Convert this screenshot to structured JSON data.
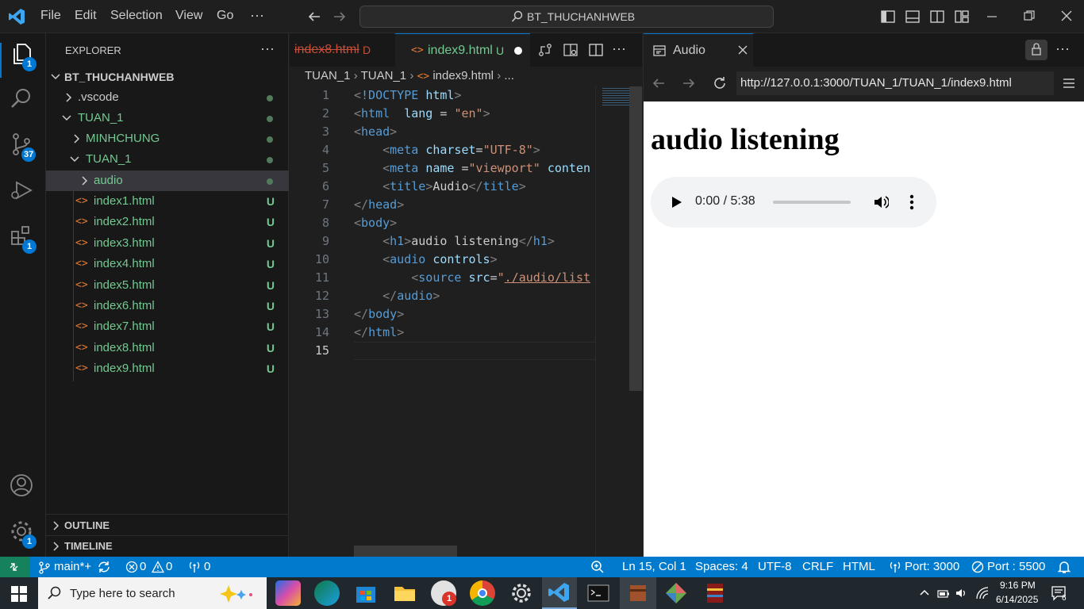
{
  "titlebar": {
    "menu": [
      "File",
      "Edit",
      "Selection",
      "View",
      "Go"
    ],
    "more": "···",
    "search_text": "BT_THUCHANHWEB"
  },
  "activity": {
    "explorer_badge": "1",
    "source_control_badge": "37",
    "extensions_badge": "1",
    "settings_badge": "1"
  },
  "sidebar": {
    "title": "EXPLORER",
    "more": "···",
    "root": "BT_THUCHANHWEB",
    "items": [
      {
        "label": ".vscode",
        "status": ""
      },
      {
        "label": "TUAN_1",
        "status": ""
      },
      {
        "label": "MINHCHUNG",
        "status": ""
      },
      {
        "label": "TUAN_1",
        "status": ""
      },
      {
        "label": "audio",
        "status": ""
      },
      {
        "label": "index1.html",
        "status": "U"
      },
      {
        "label": "index2.html",
        "status": "U"
      },
      {
        "label": "index3.html",
        "status": "U"
      },
      {
        "label": "index4.html",
        "status": "U"
      },
      {
        "label": "index5.html",
        "status": "U"
      },
      {
        "label": "index6.html",
        "status": "U"
      },
      {
        "label": "index7.html",
        "status": "U"
      },
      {
        "label": "index8.html",
        "status": "U"
      },
      {
        "label": "index9.html",
        "status": "U"
      }
    ],
    "outline": "OUTLINE",
    "timeline": "TIMELINE"
  },
  "editor": {
    "tab1": {
      "label": "index8.html",
      "status": "D"
    },
    "tab2": {
      "label": "index9.html",
      "status": "U"
    },
    "breadcrumb": [
      "TUAN_1",
      "TUAN_1",
      "index9.html",
      "..."
    ],
    "lines": [
      "1",
      "2",
      "3",
      "4",
      "5",
      "6",
      "7",
      "8",
      "9",
      "10",
      "11",
      "12",
      "13",
      "14",
      "15"
    ]
  },
  "browser": {
    "tab_title": "Audio",
    "url": "http://127.0.0.1:3000/TUAN_1/TUAN_1/index9.html",
    "heading": "audio listening",
    "audio_time": "0:00 / 5:38"
  },
  "statusbar": {
    "branch": "main*+",
    "errors": "0",
    "warnings": "0",
    "ports": "0",
    "position": "Ln 15, Col 1",
    "spaces": "Spaces: 4",
    "encoding": "UTF-8",
    "eol": "CRLF",
    "language": "HTML",
    "port1": "Port: 3000",
    "port2": "Port : 5500"
  },
  "taskbar": {
    "search_placeholder": "Type here to search",
    "time": "9:16 PM",
    "date": "6/14/2025",
    "notif_count": "6",
    "zalo_badge": "1"
  }
}
